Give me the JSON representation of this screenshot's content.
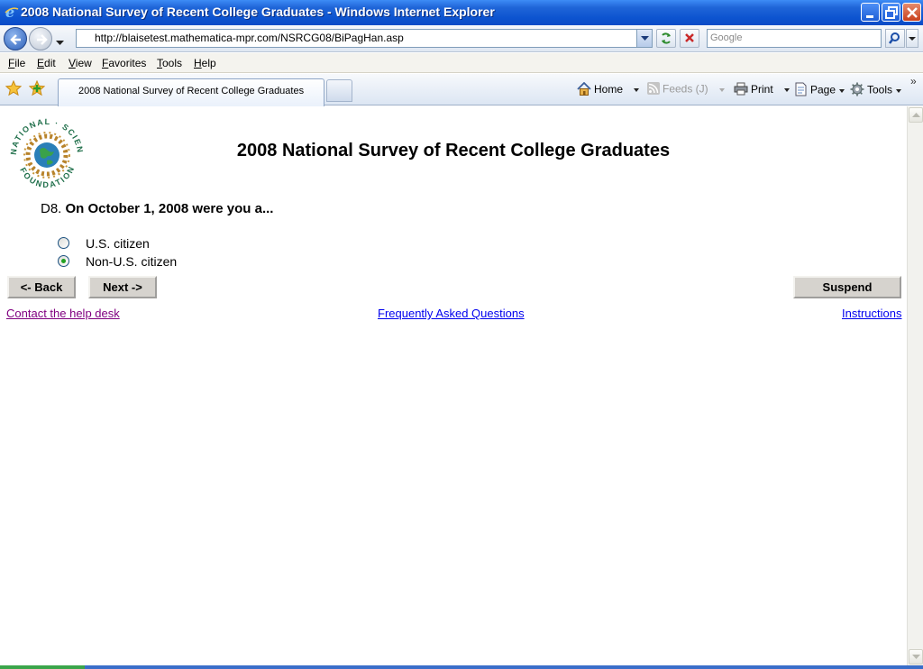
{
  "window": {
    "title": "2008 National Survey of Recent College Graduates - Windows Internet Explorer"
  },
  "address_bar": {
    "url": "http://blaisetest.mathematica-mpr.com/NSRCG08/BiPagHan.asp",
    "search_placeholder": "Google"
  },
  "menu": {
    "items": [
      "File",
      "Edit",
      "View",
      "Favorites",
      "Tools",
      "Help"
    ]
  },
  "tabs": {
    "active_label": "2008 National Survey of Recent College Graduates"
  },
  "command_bar": {
    "home": "Home",
    "feeds": "Feeds (J)",
    "print": "Print",
    "page": "Page",
    "tools": "Tools"
  },
  "logo": {
    "text_top": "NATIONAL · SCIENCE",
    "text_bottom": "FOUNDATION"
  },
  "survey": {
    "heading": "2008 National Survey of Recent College Graduates",
    "question_number": "D8.",
    "question_text": "On October 1, 2008 were you a...",
    "options": [
      {
        "label": "U.S. citizen",
        "selected": false
      },
      {
        "label": "Non-U.S. citizen",
        "selected": true
      }
    ]
  },
  "buttons": {
    "back": "<- Back",
    "next": "Next ->",
    "suspend": "Suspend"
  },
  "links": {
    "help_desk": "Contact the help desk",
    "faq": "Frequently Asked Questions",
    "instructions": "Instructions"
  }
}
